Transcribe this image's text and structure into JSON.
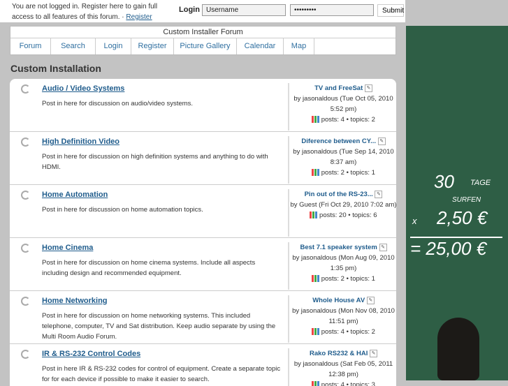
{
  "top": {
    "notice": "You are not logged in. Register here to gain full access to all features of this forum. ·",
    "register_link": "Register",
    "login_label": "Login",
    "username_value": "Username",
    "password_value": "•••••••••",
    "submit": "Submit"
  },
  "nav": {
    "title": "Custom Installer Forum",
    "items": [
      "Forum",
      "Search",
      "Login",
      "Register",
      "Picture Gallery",
      "Calendar",
      "Map"
    ]
  },
  "heading": "Custom Installation",
  "forums": [
    {
      "title": "Audio / Video Systems",
      "desc": "Post in here for discussion on audio/video systems.",
      "last_title": "TV and FreeSat",
      "last_by": "by jasonaldous (Tue Oct 05, 2010 5:52 pm)",
      "stats": "posts: 4 • topics: 2"
    },
    {
      "title": "High Definition Video",
      "desc": "Post in here for discussion on high definition systems and anything to do with HDMI.",
      "last_title": "Diference between CY...",
      "last_by": "by jasonaldous (Tue Sep 14, 2010 8:37 am)",
      "stats": "posts: 2 • topics: 1"
    },
    {
      "title": "Home Automation",
      "desc": "Post in here for discussion on home automation topics.",
      "last_title": "Pin out of the RS-23...",
      "last_by": "by Guest (Fri Oct 29, 2010 7:02 am)",
      "stats": "posts: 20 • topics: 6"
    },
    {
      "title": "Home Cinema",
      "desc": "Post in here for discussion on home cinema systems. Include all aspects including design and recommended equipment.",
      "last_title": "Best 7.1 speaker system",
      "last_by": "by jasonaldous (Mon Aug 09, 2010 1:35 pm)",
      "stats": "posts: 2 • topics: 1"
    },
    {
      "title": "Home Networking",
      "desc": "Post in here for discussion on home networking systems. This included telephone, computer, TV and Sat distribution. Keep audio separate by using the Multi Room Audio Forum.",
      "last_title": "Whole House AV",
      "last_by": "by jasonaldous (Mon Nov 08, 2010 11:51 pm)",
      "stats": "posts: 4 • topics: 2"
    },
    {
      "title": "IR & RS-232 Control Codes",
      "desc": "Post in here IR & RS-232 codes for control of equipment. Create a separate topic for for each device if possible to make it easier to search.",
      "last_title": "Rako RS232 & HAI",
      "last_by": "by jasonaldous (Sat Feb 05, 2011 12:38 pm)",
      "stats": "posts: 4 • topics: 3"
    }
  ],
  "ad": {
    "l1": "30",
    "l1b": "TAGE",
    "l2": "SURFEN",
    "l3a": "x",
    "l3": "2,50 €",
    "l4": "= 25,00 €"
  }
}
